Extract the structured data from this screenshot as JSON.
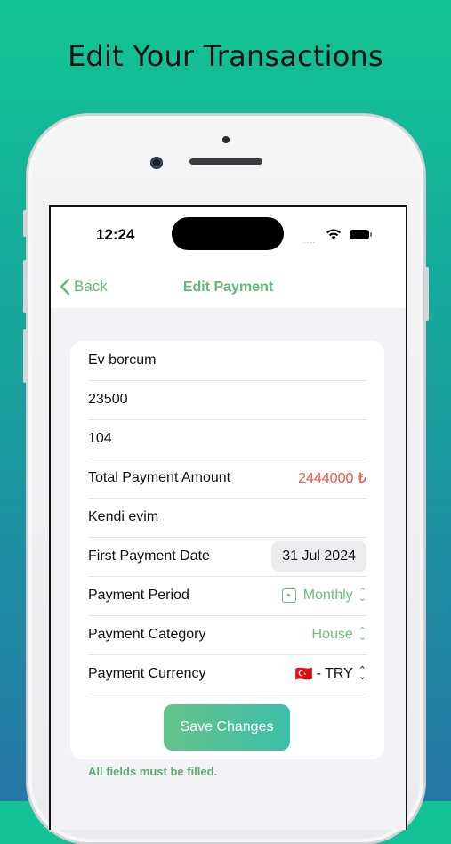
{
  "headline": "Edit Your Transactions",
  "status_bar": {
    "time": "12:24",
    "signal": "....",
    "icons": [
      "wifi-icon",
      "battery-icon"
    ]
  },
  "nav": {
    "back_label": "Back",
    "title": "Edit Payment",
    "back_icon": "chevron-left-icon"
  },
  "form": {
    "name_value": "Ev borcum",
    "amount_value": "23500",
    "count_value": "104",
    "total_label": "Total Payment Amount",
    "total_value": "2444000 ₺",
    "note_value": "Kendi evim",
    "first_date_label": "First Payment Date",
    "first_date_value": "31 Jul 2024",
    "period_label": "Payment Period",
    "period_value": "Monthly",
    "category_label": "Payment Category",
    "category_value": "House",
    "currency_label": "Payment Currency",
    "currency_flag": "🇹🇷",
    "currency_value": "- TRY",
    "save_label": "Save Changes"
  },
  "hint": "All fields must be filled.",
  "colors": {
    "accent": "#5dbb73",
    "total": "#e8534a",
    "bg_top": "#12c495",
    "bg_bottom": "#2577a6"
  }
}
